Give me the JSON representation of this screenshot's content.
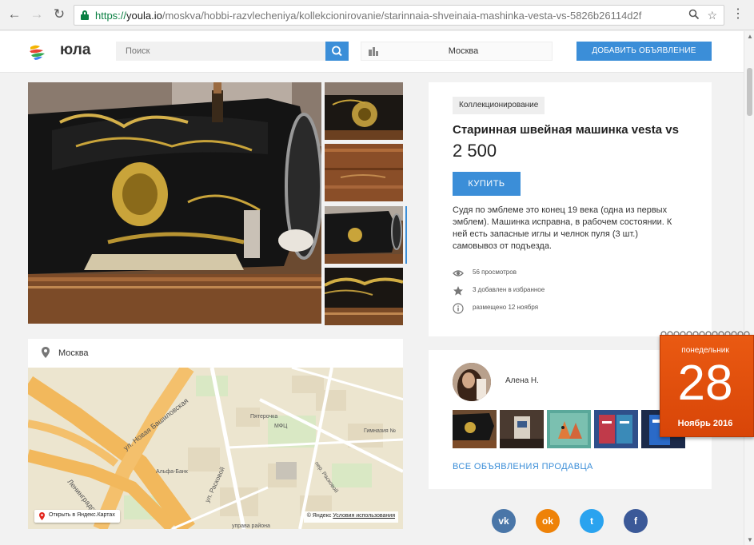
{
  "browser": {
    "url_scheme": "https://",
    "url_host": "youla.io",
    "url_path": "/moskva/hobbi-razvlecheniya/kollekcionirovanie/starinnaia-shveinaia-mashinka-vesta-vs-5826b26114d2f"
  },
  "header": {
    "logo_text": "юла",
    "search_placeholder": "Поиск",
    "city": "Москва",
    "add_button": "ДОБАВИТЬ ОБЪЯВЛЕНИЕ"
  },
  "listing": {
    "category": "Коллекционирование",
    "title": "Старинная швейная машинка vesta vs",
    "price": "2 500",
    "buy_button": "КУПИТЬ",
    "description": "Судя по эмблеме это конец 19 века (одна из первых эмблем). Машинка исправна, в рабочем состоянии. К ней есть запасные иглы и челнок пуля (3 шт.) самовывоз от подъезда.",
    "stats": {
      "views": "56 просмотров",
      "favorites": "3 добавлен в избранное",
      "posted": "размещено 12 ноября"
    }
  },
  "location": {
    "city": "Москва",
    "map_labels": {
      "street_new_bashilovskaya": "ул. Новая Башиловская",
      "street_raskovoy": "ул. Расковой",
      "lane_raskovoy": "пер. Расковой",
      "street_leningradsky": "Ленинградский",
      "alfa_bank": "Альфа-Банк",
      "pyaterochka": "Пятерочка",
      "gymnasium": "Гимназия №",
      "mfts": "МФЦ",
      "uprava": "управа района"
    },
    "map_open_label": "Открыть в Яндекс.Картах",
    "map_copyright": "© Яндекс",
    "map_terms": "Условия использования"
  },
  "seller": {
    "name": "Алена Н.",
    "all_listings_link": "ВСЕ ОБЪЯВЛЕНИЯ ПРОДАВЦА"
  },
  "social": {
    "vk": "vk",
    "ok": "ok",
    "twitter": "t",
    "facebook": "f"
  },
  "calendar": {
    "weekday": "понедельник",
    "day": "28",
    "month_year": "Ноябрь 2016"
  },
  "colors": {
    "accent": "#3b8ed8",
    "calendar": "#e2510d",
    "secure": "#0b8043"
  }
}
